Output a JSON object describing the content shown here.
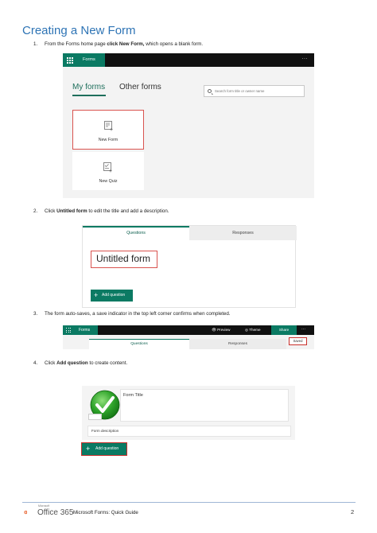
{
  "heading": "Creating a New Form",
  "steps": [
    {
      "num": "1.",
      "pre": "From the Forms home page ",
      "bold": "click New Form,",
      "post": " which opens a blank form."
    },
    {
      "num": "2.",
      "pre": "Click ",
      "bold": "Untitled form",
      "post": " to edit the title and add a description."
    },
    {
      "num": "3.",
      "pre": "The form auto-saves, a save indicator in the top left corner confirms when completed.",
      "bold": "",
      "post": ""
    },
    {
      "num": "4.",
      "pre": "Click ",
      "bold": "Add question",
      "post": " to create content."
    }
  ],
  "shot1": {
    "app_name": "Forms",
    "more": "···",
    "tab_my": "My forms",
    "tab_other": "Other forms",
    "search_placeholder": "Search form title or owner name",
    "card_new": "New Form",
    "card_quiz": "New Quiz"
  },
  "shot2": {
    "tab_questions": "Questions",
    "tab_responses": "Responses",
    "title": "Untitled form",
    "add_question": "Add question"
  },
  "shot3": {
    "app_name": "Forms",
    "preview": "Preview",
    "theme": "Theme",
    "share": "Share",
    "more": "···",
    "tab_questions": "Questions",
    "tab_responses": "Responses",
    "saved": "Saved"
  },
  "shot4": {
    "form_title": "Form Title",
    "form_description": "Form description",
    "add_question": "Add question"
  },
  "footer": {
    "microsoft": "Microsoft",
    "office": "Office 365",
    "guide": "Microsoft Forms: Quick Guide",
    "page": "2"
  },
  "colors": {
    "accent": "#0b7a63",
    "heading": "#2e74b5",
    "highlight": "#d9534f"
  }
}
